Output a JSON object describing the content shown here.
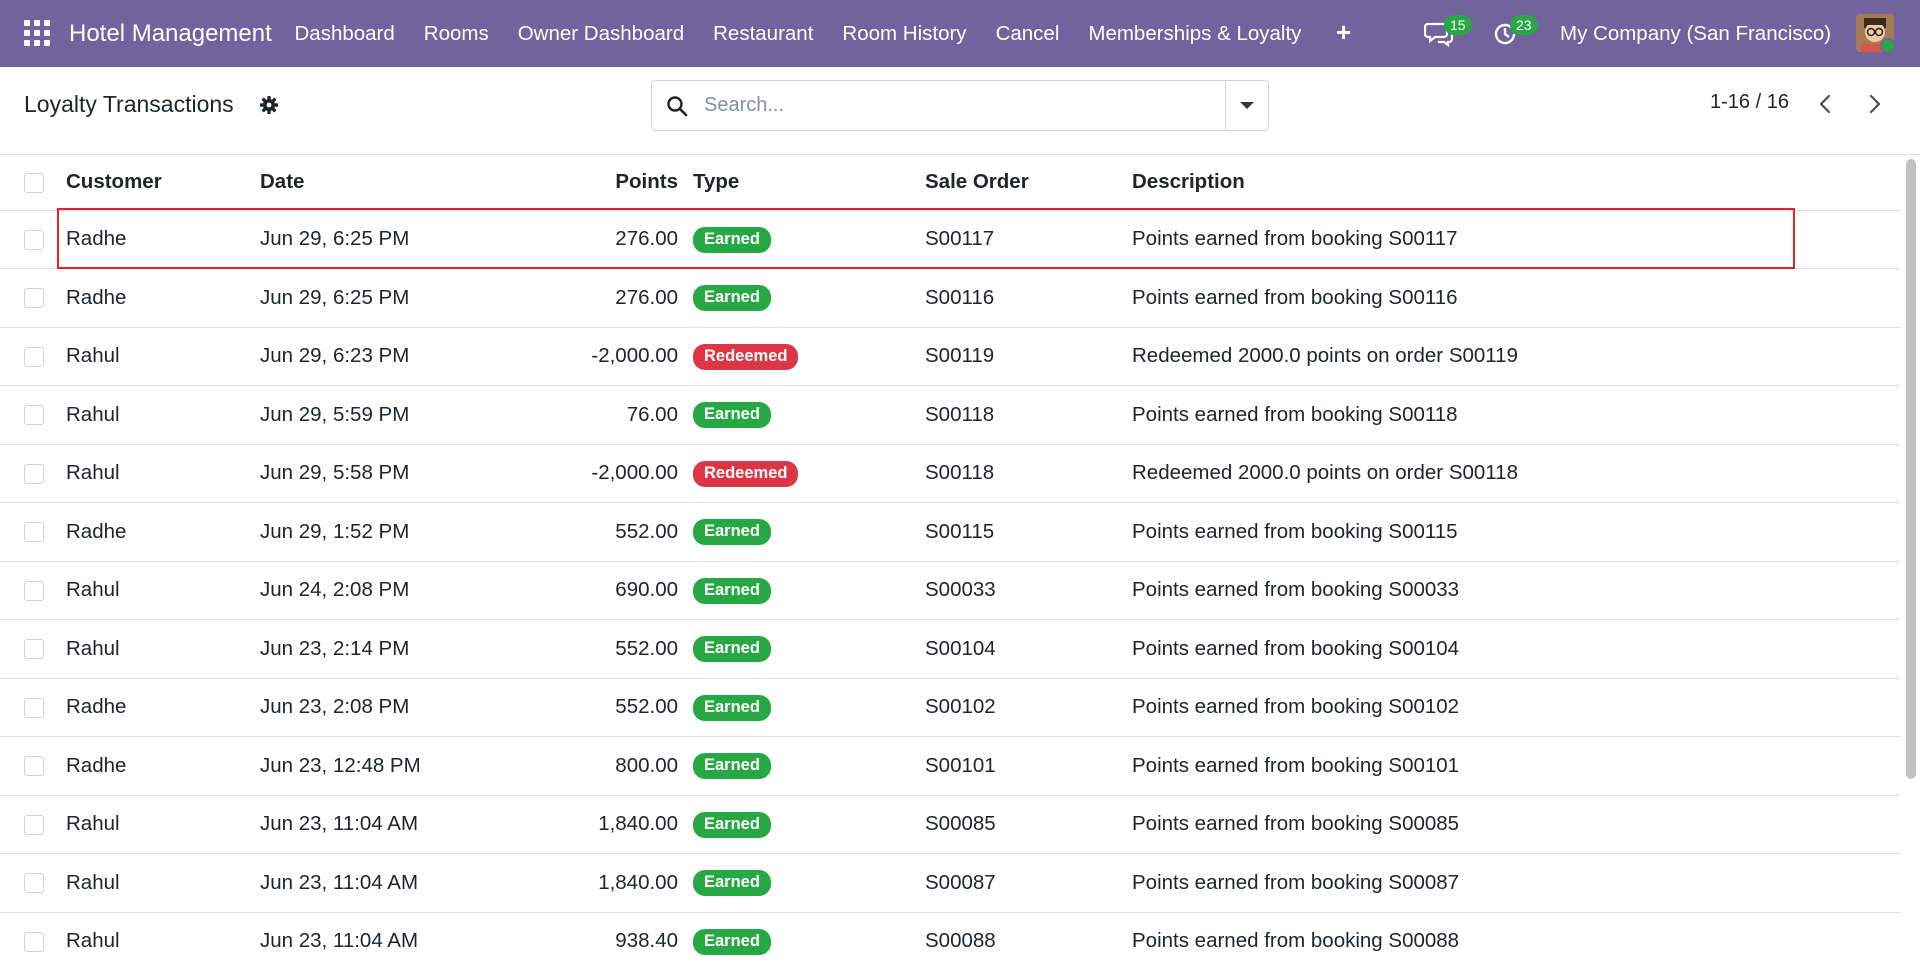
{
  "navbar": {
    "brand": "Hotel Management",
    "menu": [
      {
        "label": "Dashboard"
      },
      {
        "label": "Rooms"
      },
      {
        "label": "Owner Dashboard"
      },
      {
        "label": "Restaurant"
      },
      {
        "label": "Room History"
      },
      {
        "label": "Cancel"
      },
      {
        "label": "Memberships & Loyalty"
      }
    ],
    "plus": "+",
    "messages_count": "15",
    "activities_count": "23",
    "company": "My Company (San Francisco)"
  },
  "control": {
    "title": "Loyalty Transactions",
    "search_placeholder": "Search...",
    "pager": "1-16 / 16"
  },
  "table": {
    "headers": {
      "customer": "Customer",
      "date": "Date",
      "points": "Points",
      "type": "Type",
      "sale_order": "Sale Order",
      "description": "Description"
    },
    "rows": [
      {
        "customer": "Radhe",
        "date": "Jun 29, 6:25 PM",
        "points": "276.00",
        "type": "Earned",
        "sale_order": "S00117",
        "description": "Points earned from booking S00117"
      },
      {
        "customer": "Radhe",
        "date": "Jun 29, 6:25 PM",
        "points": "276.00",
        "type": "Earned",
        "sale_order": "S00116",
        "description": "Points earned from booking S00116"
      },
      {
        "customer": "Rahul",
        "date": "Jun 29, 6:23 PM",
        "points": "-2,000.00",
        "type": "Redeemed",
        "sale_order": "S00119",
        "description": "Redeemed 2000.0 points on order S00119"
      },
      {
        "customer": "Rahul",
        "date": "Jun 29, 5:59 PM",
        "points": "76.00",
        "type": "Earned",
        "sale_order": "S00118",
        "description": "Points earned from booking S00118"
      },
      {
        "customer": "Rahul",
        "date": "Jun 29, 5:58 PM",
        "points": "-2,000.00",
        "type": "Redeemed",
        "sale_order": "S00118",
        "description": "Redeemed 2000.0 points on order S00118"
      },
      {
        "customer": "Radhe",
        "date": "Jun 29, 1:52 PM",
        "points": "552.00",
        "type": "Earned",
        "sale_order": "S00115",
        "description": "Points earned from booking S00115"
      },
      {
        "customer": "Rahul",
        "date": "Jun 24, 2:08 PM",
        "points": "690.00",
        "type": "Earned",
        "sale_order": "S00033",
        "description": "Points earned from booking S00033"
      },
      {
        "customer": "Rahul",
        "date": "Jun 23, 2:14 PM",
        "points": "552.00",
        "type": "Earned",
        "sale_order": "S00104",
        "description": "Points earned from booking S00104"
      },
      {
        "customer": "Radhe",
        "date": "Jun 23, 2:08 PM",
        "points": "552.00",
        "type": "Earned",
        "sale_order": "S00102",
        "description": "Points earned from booking S00102"
      },
      {
        "customer": "Radhe",
        "date": "Jun 23, 12:48 PM",
        "points": "800.00",
        "type": "Earned",
        "sale_order": "S00101",
        "description": "Points earned from booking S00101"
      },
      {
        "customer": "Rahul",
        "date": "Jun 23, 11:04 AM",
        "points": "1,840.00",
        "type": "Earned",
        "sale_order": "S00085",
        "description": "Points earned from booking S00085"
      },
      {
        "customer": "Rahul",
        "date": "Jun 23, 11:04 AM",
        "points": "1,840.00",
        "type": "Earned",
        "sale_order": "S00087",
        "description": "Points earned from booking S00087"
      },
      {
        "customer": "Rahul",
        "date": "Jun 23, 11:04 AM",
        "points": "938.40",
        "type": "Earned",
        "sale_order": "S00088",
        "description": "Points earned from booking S00088"
      }
    ]
  },
  "colors": {
    "navbar": "#71639e",
    "earned": "#28a745",
    "redeemed": "#dc3545",
    "highlight": "#e5242a"
  }
}
